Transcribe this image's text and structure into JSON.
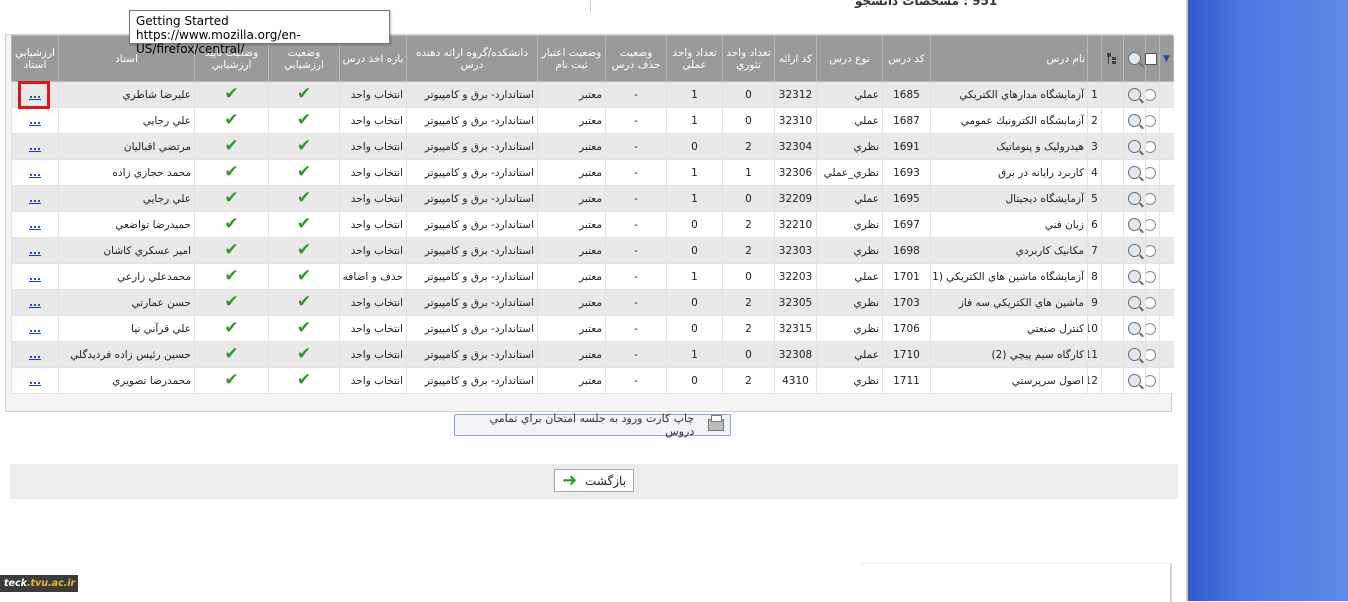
{
  "top": {
    "fragment_text": "951 : ﻣﺸﺨﺼﺎﺕ ﺩﺍﻧﺸﺠﻮ"
  },
  "tooltip": {
    "title": "Getting Started",
    "url": "https://www.mozilla.org/en-US/firefox/central/"
  },
  "table": {
    "headers": {
      "course_name": "نام درس",
      "course_code": "كد درس",
      "course_type": "نوع درس",
      "offer_code": "كد ارائه",
      "theory_units": "تعداد واحد تئوري",
      "practical_units": "تعداد واحد عملي",
      "removal_status": "وضعيت حذف درس",
      "registration_status": "وضعيت اعتبار ثبت نام",
      "faculty": "دانشكده/گروه ارائه دهنده درس",
      "period": "بازه اخذ درس",
      "evaluation_status": "وضعيت ارزشيابي",
      "eval_confirm_status": "وضعيت تاييد ارزشيابي",
      "instructor": "استاد",
      "instructor_evaluation": "ارزشيابي استاد"
    },
    "rows": [
      {
        "num": "1",
        "name": "آزمايشگاه مدارهاي الكتريكي",
        "code": "1685",
        "type": "عملي",
        "offer": "32312",
        "theory": "0",
        "practical": "1",
        "removal": "-",
        "valid": "معتبر",
        "faculty": "استاندارد- برق و كامپيوتر",
        "period": "انتخاب واحد",
        "instructor": "عليرضا شاطري",
        "eval_link": "..."
      },
      {
        "num": "2",
        "name": "آزمايشگاه الكترونيك عمومي",
        "code": "1687",
        "type": "عملي",
        "offer": "32310",
        "theory": "0",
        "practical": "1",
        "removal": "-",
        "valid": "معتبر",
        "faculty": "استاندارد- برق و كامپيوتر",
        "period": "انتخاب واحد",
        "instructor": "علي رجايي",
        "eval_link": "..."
      },
      {
        "num": "3",
        "name": "هيدروليک و پنوماتيک",
        "code": "1691",
        "type": "نظري",
        "offer": "32304",
        "theory": "2",
        "practical": "0",
        "removal": "-",
        "valid": "معتبر",
        "faculty": "استاندارد- برق و كامپيوتر",
        "period": "انتخاب واحد",
        "instructor": "مرتضي اقباليان",
        "eval_link": "..."
      },
      {
        "num": "4",
        "name": "كاربرد رايانه در برق",
        "code": "1693",
        "type": "نظري_عملي",
        "offer": "32306",
        "theory": "1",
        "practical": "1",
        "removal": "-",
        "valid": "معتبر",
        "faculty": "استاندارد- برق و كامپيوتر",
        "period": "انتخاب واحد",
        "instructor": "محمد حجازي زاده",
        "eval_link": "..."
      },
      {
        "num": "5",
        "name": "آزمايشگاه ديجيتال",
        "code": "1695",
        "type": "عملي",
        "offer": "32209",
        "theory": "0",
        "practical": "1",
        "removal": "-",
        "valid": "معتبر",
        "faculty": "استاندارد- برق و كامپيوتر",
        "period": "انتخاب واحد",
        "instructor": "علي رجايي",
        "eval_link": "..."
      },
      {
        "num": "6",
        "name": "زبان فني",
        "code": "1697",
        "type": "نظري",
        "offer": "32210",
        "theory": "2",
        "practical": "0",
        "removal": "-",
        "valid": "معتبر",
        "faculty": "استاندارد- برق و كامپيوتر",
        "period": "انتخاب واحد",
        "instructor": "حميدرضا تواضعي",
        "eval_link": "..."
      },
      {
        "num": "7",
        "name": "مكانيک كاربردي",
        "code": "1698",
        "type": "نظري",
        "offer": "32303",
        "theory": "2",
        "practical": "0",
        "removal": "-",
        "valid": "معتبر",
        "faculty": "استاندارد- برق و كامپيوتر",
        "period": "انتخاب واحد",
        "instructor": "امير عسكري كاشان",
        "eval_link": "..."
      },
      {
        "num": "8",
        "name": "آزمايشگاه ماشين هاي الكتريكي (1)",
        "code": "1701",
        "type": "عملي",
        "offer": "32203",
        "theory": "0",
        "practical": "1",
        "removal": "-",
        "valid": "معتبر",
        "faculty": "استاندارد- برق و كامپيوتر",
        "period": "حذف و اضافه",
        "instructor": "محمدعلي زارعي",
        "eval_link": "..."
      },
      {
        "num": "9",
        "name": "ماشين هاي الكتريكي سه فاز",
        "code": "1703",
        "type": "نظري",
        "offer": "32305",
        "theory": "2",
        "practical": "0",
        "removal": "-",
        "valid": "معتبر",
        "faculty": "استاندارد- برق و كامپيوتر",
        "period": "انتخاب واحد",
        "instructor": "حسن عمارتي",
        "eval_link": "..."
      },
      {
        "num": "10",
        "name": "كنترل صنعتي",
        "code": "1706",
        "type": "نظري",
        "offer": "32315",
        "theory": "2",
        "practical": "0",
        "removal": "-",
        "valid": "معتبر",
        "faculty": "استاندارد- برق و كامپيوتر",
        "period": "انتخاب واحد",
        "instructor": "علي قرآني نيا",
        "eval_link": "..."
      },
      {
        "num": "11",
        "name": "كارگاه سيم پيچي (2)",
        "code": "1710",
        "type": "عملي",
        "offer": "32308",
        "theory": "0",
        "practical": "1",
        "removal": "-",
        "valid": "معتبر",
        "faculty": "استاندارد- برق و كامپيوتر",
        "period": "انتخاب واحد",
        "instructor": "حسين رئيس زاده فرديدگلي",
        "eval_link": "..."
      },
      {
        "num": "12",
        "name": "اصول سرپرستي",
        "code": "1711",
        "type": "نظري",
        "offer": "4310",
        "theory": "2",
        "practical": "0",
        "removal": "-",
        "valid": "معتبر",
        "faculty": "استاندارد- برق و كامپيوتر",
        "period": "انتخاب واحد",
        "instructor": "محمدرضا تصويري",
        "eval_link": "..."
      }
    ]
  },
  "print_button": {
    "label": "چاپ كارت ورود به جلسه امتحان براي تمامي دروس"
  },
  "back_button": {
    "label": "بازگشت"
  },
  "watermark": {
    "prefix": "teck",
    "suffix": ".tvu.ac.ir"
  },
  "colors": {
    "header_bg": "#9a9a9a",
    "row_alt": "#e9e9e9",
    "check": "#2e9a2e",
    "link": "#1b3fa8",
    "highlight": "#e0141e",
    "side_panel": "#4b78e0"
  },
  "icons": {
    "check": "check-icon",
    "view": "magnifier-icon",
    "print": "printer-icon",
    "back": "green-arrow-icon"
  }
}
